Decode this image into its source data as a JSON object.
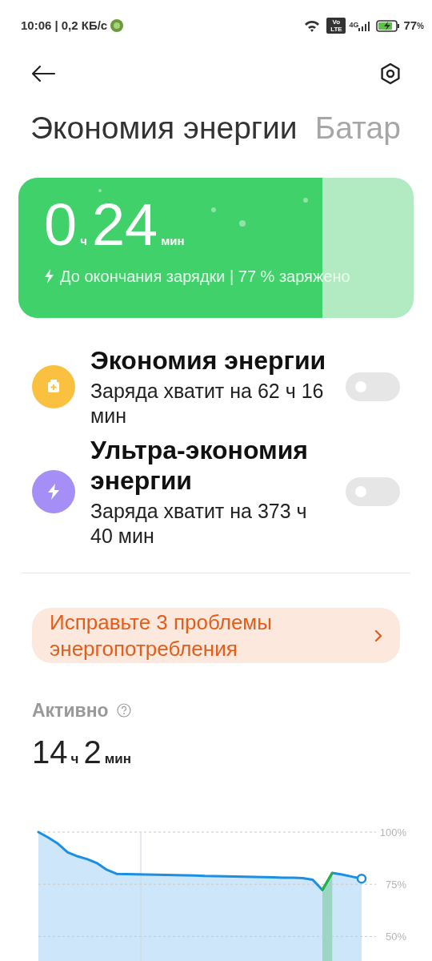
{
  "status_bar": {
    "time": "10:06",
    "speed": "| 0,2 КБ/с",
    "volte_top": "Vo",
    "volte_bottom": "LTE",
    "network": "4G",
    "battery_percent": "77",
    "percent_sign": "%"
  },
  "tabs": [
    {
      "label": "Экономия энергии",
      "selected": true
    },
    {
      "label": "Батар",
      "selected": false
    }
  ],
  "charge_card": {
    "hours": "0",
    "hours_unit": "ч",
    "minutes": "24",
    "minutes_unit": "мин",
    "caption": "До окончания зарядки | 77 % заряжено",
    "level": 0.77
  },
  "modes": [
    {
      "title": "Экономия энергии",
      "subtitle": "Заряда хватит на 62 ч 16 мин",
      "color": "#f9c13f",
      "on": false
    },
    {
      "title": "Ультра-экономия энергии",
      "subtitle": "Заряда хватит на 373 ч 40 мин",
      "color": "#a58ef5",
      "on": false
    }
  ],
  "issues_banner": {
    "text": "Исправьте 3 проблемы энергопотребления"
  },
  "active": {
    "label": "Активно",
    "hours": "14",
    "hours_unit": "ч",
    "minutes": "2",
    "minutes_unit": "мин",
    "chart_data": {
      "type": "area",
      "categories": [
        null,
        null,
        null,
        null,
        null,
        null,
        null,
        null,
        null,
        null,
        null,
        null,
        null,
        null,
        null,
        null,
        null,
        null,
        null,
        null,
        null,
        null,
        null,
        null,
        null,
        null,
        null,
        null,
        null,
        null,
        null,
        null,
        null,
        null
      ],
      "grid": true,
      "ylim": [
        31,
        100
      ],
      "yticks": [
        {
          "value": 100,
          "label": "100%"
        },
        {
          "value": 75,
          "label": "75%"
        },
        {
          "value": 50,
          "label": "50%"
        }
      ],
      "series": [
        {
          "color": "#1a8fe3",
          "values": [
            100,
            97.4,
            94.4,
            90.3,
            88.4,
            87,
            85.1,
            81.9,
            80,
            79.9,
            79.8,
            79.7,
            79.6,
            79.5,
            79.4,
            79.3,
            79.2,
            79,
            78.9,
            78.8,
            78.7,
            78.6,
            78.5,
            78.4,
            78.3,
            78.2,
            78.1,
            78,
            77.2,
            72.3,
            80.4,
            79.7,
            78.7,
            77.7
          ]
        },
        {
          "color": "#26b33f",
          "values": [
            null,
            null,
            null,
            null,
            null,
            null,
            null,
            null,
            null,
            null,
            null,
            null,
            null,
            null,
            null,
            null,
            null,
            null,
            null,
            null,
            null,
            null,
            null,
            null,
            null,
            null,
            null,
            null,
            null,
            72.3,
            80.4,
            null,
            null,
            null
          ]
        }
      ]
    }
  }
}
